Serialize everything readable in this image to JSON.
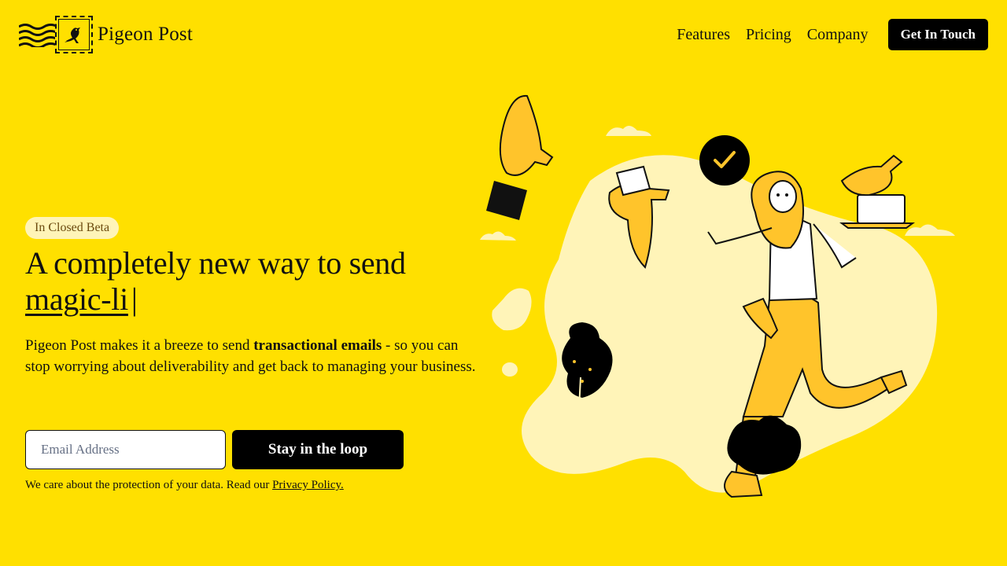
{
  "brand": {
    "name": "Pigeon Post"
  },
  "nav": {
    "links": [
      "Features",
      "Pricing",
      "Company"
    ],
    "cta_label": "Get In Touch"
  },
  "hero": {
    "badge": "In Closed Beta",
    "headline_prefix": "A completely new way to send",
    "headline_typed": "magic-li",
    "cursor": "|",
    "description_part1": "Pigeon Post makes it a breeze to send ",
    "description_bold": "transactional emails",
    "description_part2": " - so you can stop worrying about deliverability and get back to managing your business.",
    "email_placeholder": "Email Address",
    "email_value": "",
    "subscribe_label": "Stay in the loop",
    "privacy_text": "We care about the protection of your data. Read our ",
    "privacy_link": "Privacy Policy."
  },
  "colors": {
    "background": "#FFE000",
    "accent": "#FFC42B",
    "blob": "#FFF4B8",
    "dark": "#000000"
  },
  "icons": [
    "wavy-lines-icon",
    "pigeon-stamp-icon",
    "checkmark-icon"
  ]
}
